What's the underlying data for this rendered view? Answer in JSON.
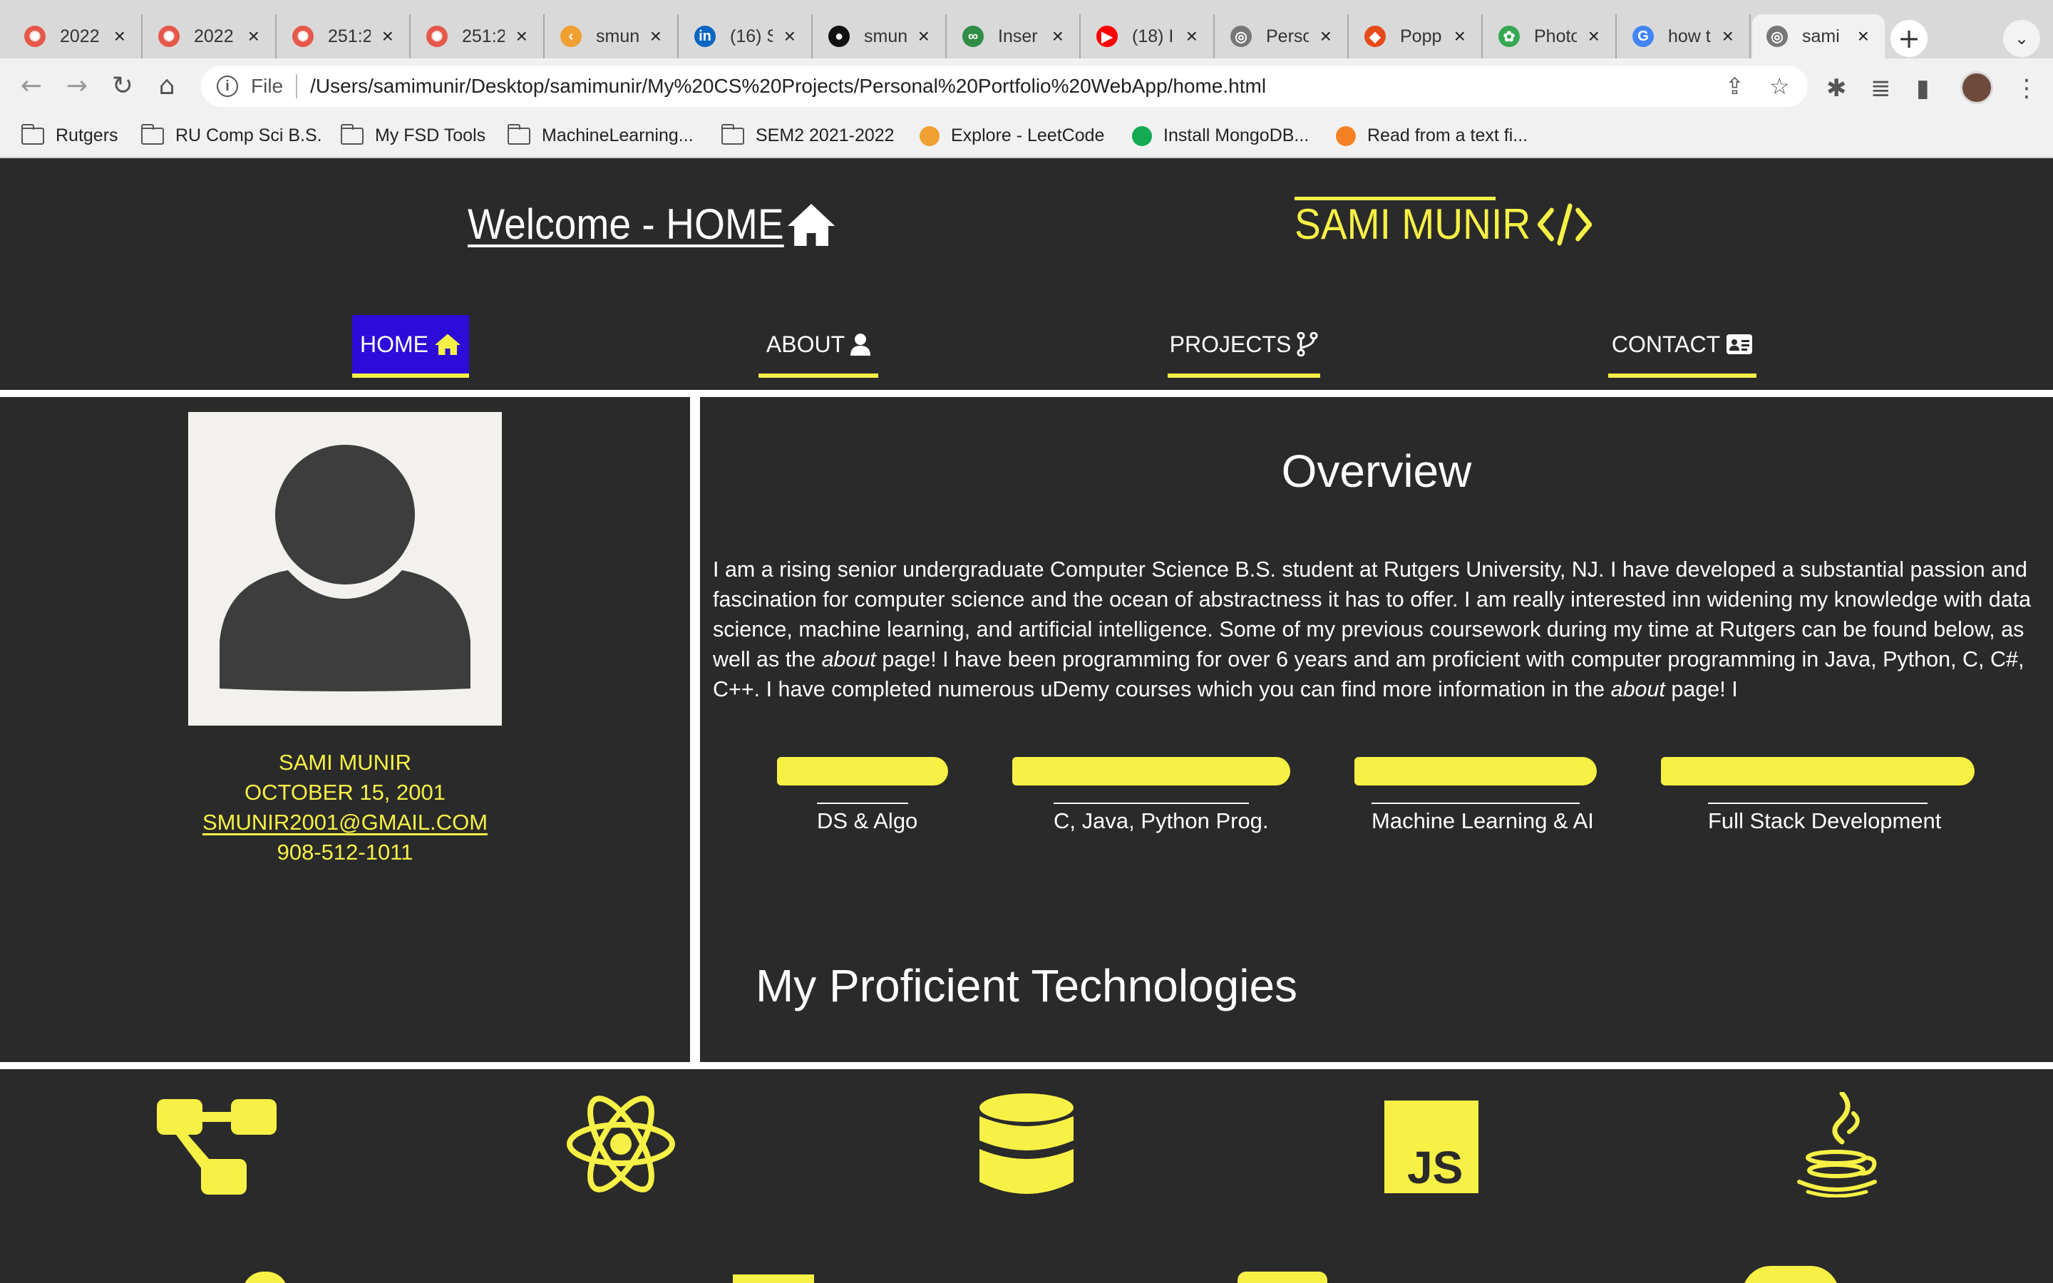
{
  "browser": {
    "tabs": [
      {
        "label": "2022",
        "fav_color": "#e5584a",
        "fav_glyph": "gear-icon"
      },
      {
        "label": "2022",
        "fav_color": "#e5584a",
        "fav_glyph": "gear-icon"
      },
      {
        "label": "251:2",
        "fav_color": "#e5584a",
        "fav_glyph": "gear-icon"
      },
      {
        "label": "251:2",
        "fav_color": "#e5584a",
        "fav_glyph": "gear-icon"
      },
      {
        "label": "smun",
        "fav_color": "#f0a030",
        "fav_glyph": "leetcode-icon"
      },
      {
        "label": "(16) S",
        "fav_color": "#0a66c2",
        "fav_glyph": "linkedin-icon"
      },
      {
        "label": "smun",
        "fav_color": "#111111",
        "fav_glyph": "github-icon"
      },
      {
        "label": "Inser",
        "fav_color": "#2f8d46",
        "fav_glyph": "geeksforgeeks-icon"
      },
      {
        "label": "(18) I",
        "fav_color": "#ff0000",
        "fav_glyph": "youtube-icon"
      },
      {
        "label": "Perso",
        "fav_color": "#777777",
        "fav_glyph": "globe-icon"
      },
      {
        "label": "Popp",
        "fav_color": "#e64a19",
        "fav_glyph": "figma-icon"
      },
      {
        "label": "Photo",
        "fav_color": "#34a853",
        "fav_glyph": "photos-icon"
      },
      {
        "label": "how t",
        "fav_color": "#4285f4",
        "fav_glyph": "google-icon"
      },
      {
        "label": "sami",
        "fav_color": "#777777",
        "fav_glyph": "globe-icon"
      }
    ],
    "new_tab": "+",
    "address": {
      "scheme": "File",
      "url": "/Users/samimunir/Desktop/samimunir/My%20CS%20Projects/Personal%20Portfolio%20WebApp/home.html"
    },
    "bookmarks": [
      {
        "label": "Rutgers",
        "type": "folder"
      },
      {
        "label": "RU Comp Sci B.S.",
        "type": "folder"
      },
      {
        "label": "My FSD Tools",
        "type": "folder"
      },
      {
        "label": "MachineLearning...",
        "type": "folder"
      },
      {
        "label": "SEM2 2021-2022",
        "type": "folder"
      },
      {
        "label": "Explore - LeetCode",
        "type": "link",
        "fav_color": "#f0a030"
      },
      {
        "label": "Install MongoDB...",
        "type": "link",
        "fav_color": "#13aa52"
      },
      {
        "label": "Read from a text fi...",
        "type": "link",
        "fav_color": "#f48024"
      }
    ]
  },
  "page": {
    "accent": "#f7f146",
    "background": "#2a2a2a",
    "nav_active_bg": "#2d0bd8",
    "header": {
      "welcome": "Welcome - HOME",
      "logo": "SAMI MUNIR"
    },
    "nav": [
      {
        "label": "HOME",
        "icon": "home-icon",
        "active": true
      },
      {
        "label": "ABOUT",
        "icon": "user-icon",
        "active": false
      },
      {
        "label": "PROJECTS",
        "icon": "code-branch-icon",
        "active": false
      },
      {
        "label": "CONTACT",
        "icon": "id-card-icon",
        "active": false
      }
    ],
    "profile": {
      "name": "SAMI MUNIR",
      "dob": "OCTOBER 15, 2001",
      "email": "SMUNIR2001@GMAIL.COM",
      "phone": "908-512-1011"
    },
    "overview": {
      "title": "Overview",
      "p1": "I am a rising senior undergraduate Computer Science B.S. student at Rutgers University, NJ. I have developed a substantial passion and fascination for computer science and the ocean of abstractness it has to offer. I am really interested inn widening my knowledge with data science, machine learning, and artificial intelligence. Some of my previous coursework during my time at Rutgers can be found below, as well as the ",
      "em1": "about",
      "p2": " page! I have been programming for over 6 years and am proficient with computer programming in Java, Python, C, C#, C++. I have completed numerous uDemy courses which you can find more information in the ",
      "em2": "about",
      "p3": " page! I"
    },
    "skills": [
      {
        "label": "DS & Algo"
      },
      {
        "label": "C, Java, Python Prog."
      },
      {
        "label": "Machine Learning & AI"
      },
      {
        "label": "Full Stack Development"
      }
    ],
    "technologies": {
      "title": "My Proficient Technologies",
      "icons": [
        "sitemap-icon",
        "react-icon",
        "database-icon",
        "javascript-icon",
        "java-icon"
      ]
    }
  }
}
